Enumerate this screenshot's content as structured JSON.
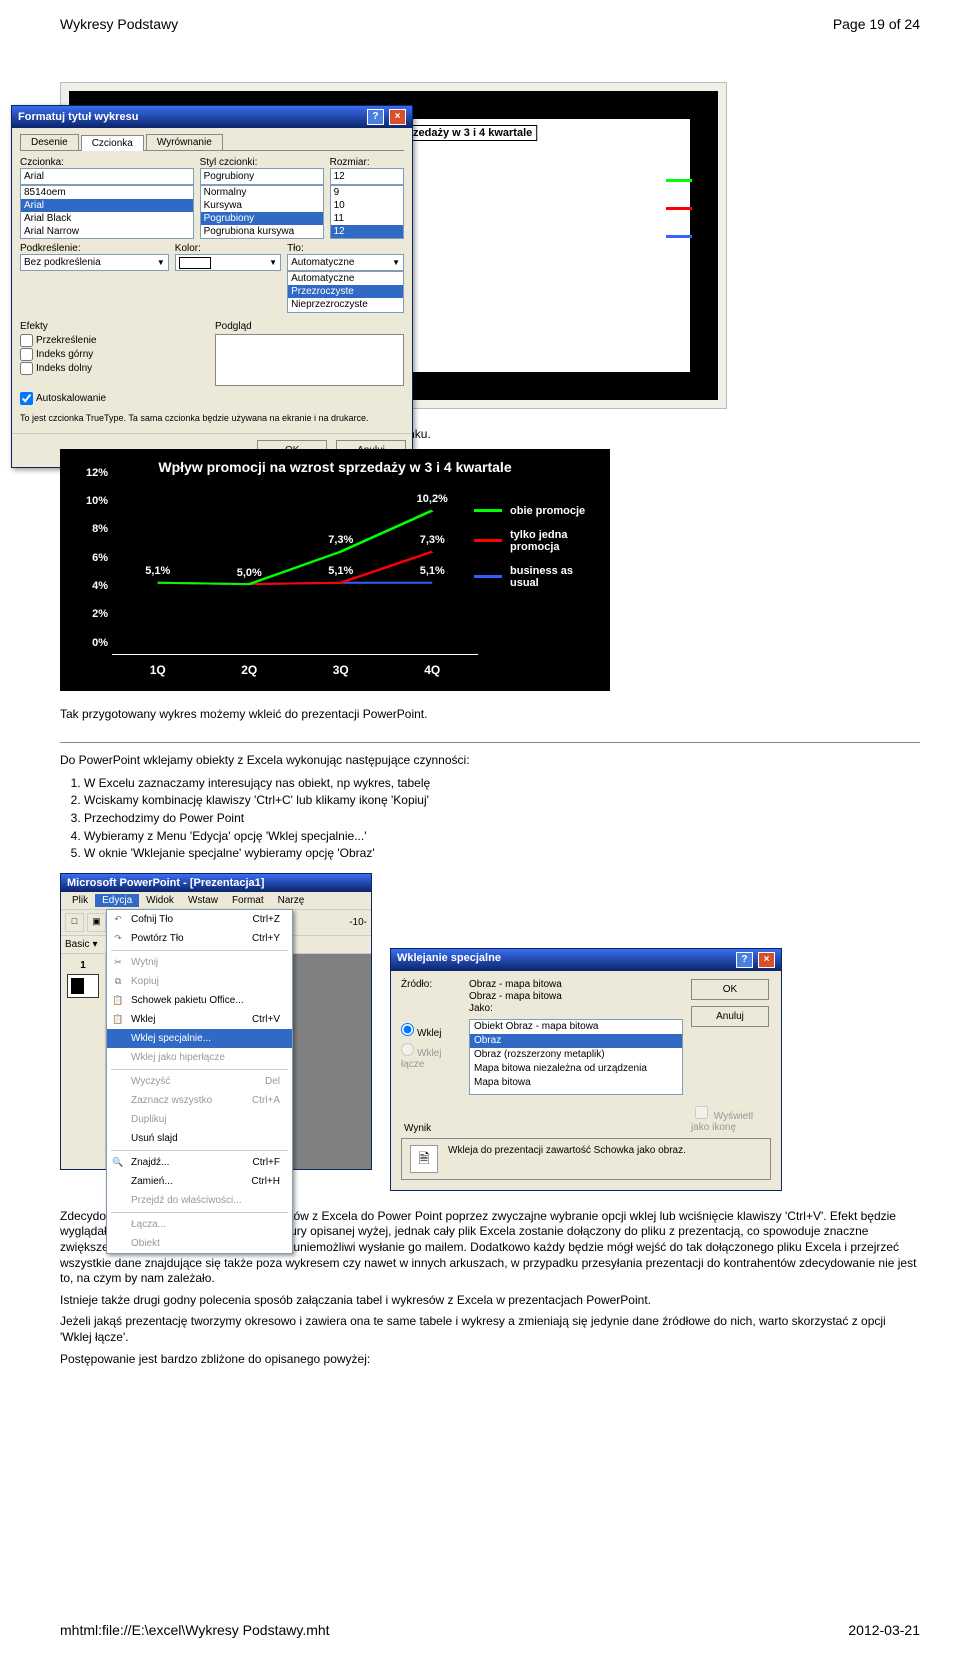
{
  "header": {
    "title": "Wykresy Podstawy",
    "page": "Page 19 of 24"
  },
  "footer": {
    "path": "mhtml:file://E:\\excel\\Wykresy Podstawy.mht",
    "date": "2012-03-21"
  },
  "text": {
    "p1": "W efekcie uzyskamy wykres taki jak pokazany na poniższym rysunku.",
    "p2": "Tak przygotowany wykres możemy wkleić do prezentacji PowerPoint.",
    "p3": "Do PowerPoint wklejamy obiekty z Excela wykonując następujące czynności:",
    "list": [
      "W Excelu zaznaczamy interesujący nas obiekt, np wykres, tabelę",
      "Wciskamy kombinację klawiszy 'Ctrl+C' lub klikamy ikonę 'Kopiuj'",
      "Przechodzimy do Power Point",
      "Wybieramy z Menu 'Edycja' opcję 'Wklej specjalnie...'",
      "W oknie 'Wklejanie specjalne' wybieramy opcję 'Obraz'"
    ],
    "p4": "Zdecydowanie nie polecam wklejania obiektów z Excela do Power Point poprzez zwyczajne wybranie opcji wklej lub wciśnięcie klawiszy 'Ctrl+V'. Efekt będzie wyglądał tak samo jak korzystając z procedury opisanej wyżej, jednak cały plik Excela zostanie dołączony do pliku z prezentacją, co spowoduje znaczne zwiększenie rozmiaru pliku prezentacji i np. uniemożliwi wysłanie go mailem. Dodatkowo każdy będzie mógł wejść do tak dołączonego pliku Excela i przejrzeć wszystkie dane znajdujące się także poza wykresem czy nawet w innych arkuszach, w przypadku przesyłania prezentacji do kontrahentów zdecydowanie nie jest to, na czym by nam zależało.",
    "p5": "Istnieje także drugi godny polecenia sposób załączania tabel i wykresów z Excela w prezentacjach PowerPoint.",
    "p6": "Jeżeli jakąś prezentację tworzymy okresowo i zawiera ona te same tabele i wykresy a zmieniają się jedynie dane źródłowe do nich, warto skorzystać z opcji 'Wklej łącze'.",
    "p7": "Postępowanie jest bardzo zbliżone do opisanego powyżej:"
  },
  "format_dialog": {
    "title": "Formatuj tytuł wykresu",
    "tabs": {
      "t1": "Desenie",
      "t2": "Czcionka",
      "t3": "Wyrównanie"
    },
    "labels": {
      "font": "Czcionka:",
      "style": "Styl czcionki:",
      "size": "Rozmiar:",
      "underline": "Podkreślenie:",
      "color": "Kolor:",
      "background": "Tło:",
      "effects": "Efekty",
      "preview": "Podgląd"
    },
    "values": {
      "font": "Arial",
      "style": "Pogrubiony",
      "size": "12",
      "underline": "Bez podkreślenia",
      "color": "",
      "background": "Automatyczne"
    },
    "font_list": {
      "i1": "8514oem",
      "i2": "Arial",
      "i3": "Arial Black",
      "i4": "Arial Narrow"
    },
    "style_list": {
      "i1": "Normalny",
      "i2": "Kursywa",
      "i3": "Pogrubiony",
      "i4": "Pogrubiona kursywa"
    },
    "size_list": {
      "i1": "9",
      "i2": "10",
      "i3": "11",
      "i4": "12"
    },
    "bg_list": {
      "i1": "Automatyczne",
      "i2": "Przezroczyste",
      "i3": "Nieprzezroczyste"
    },
    "effects": {
      "strike": "Przekreślenie",
      "super": "Indeks górny",
      "sub": "Indeks dolny",
      "autoscale": "Autoskalowanie"
    },
    "note": "To jest czcionka TrueType. Ta sama czcionka będzie używana na ekranie i na drukarce.",
    "buttons": {
      "ok": "OK",
      "cancel": "Anuluj"
    },
    "chart_title": "Wpływ promocji na wzrost sprzedaży w 3 i 4 kwartale"
  },
  "chart_data": {
    "type": "line",
    "title": "Wpływ promocji na wzrost sprzedaży w 3 i 4 kwartale",
    "categories": [
      "1Q",
      "2Q",
      "3Q",
      "4Q"
    ],
    "ylim": [
      0,
      12
    ],
    "yticks": [
      "0%",
      "2%",
      "4%",
      "6%",
      "8%",
      "10%",
      "12%"
    ],
    "series": [
      {
        "name": "obie promocje",
        "color": "#00ff00",
        "values": [
          5.1,
          5.0,
          7.3,
          10.2
        ]
      },
      {
        "name": "tylko jedna promocja",
        "color": "#ff0000",
        "values": [
          5.1,
          5.0,
          5.1,
          7.3
        ]
      },
      {
        "name": "business as usual",
        "color": "#3060ff",
        "values": [
          5.1,
          5.0,
          5.1,
          5.1
        ]
      }
    ],
    "labels": {
      "l51a": "5,1%",
      "l50": "5,0%",
      "l51b": "5,1%",
      "l51c": "5,1%",
      "l73a": "7,3%",
      "l73b": "7,3%",
      "l102": "10,2%"
    },
    "legend": {
      "s0": "obie promocje",
      "s1": "tylko jedna promocja",
      "s2": "business as usual"
    }
  },
  "pp": {
    "title": "Microsoft PowerPoint - [Prezentacja1]",
    "menu": {
      "plik": "Plik",
      "edycja": "Edycja",
      "widok": "Widok",
      "wstaw": "Wstaw",
      "format": "Format",
      "narz": "Narzę"
    },
    "toolbar": {
      "basic": "Basic"
    },
    "zoom": "-10-",
    "slide_num": "1"
  },
  "edit_menu": {
    "undo": "Cofnij Tło",
    "undo_sc": "Ctrl+Z",
    "redo": "Powtórz Tło",
    "redo_sc": "Ctrl+Y",
    "cut": "Wytnij",
    "copy": "Kopiuj",
    "office_clip": "Schowek pakietu Office...",
    "paste": "Wklej",
    "paste_sc": "Ctrl+V",
    "paste_special": "Wklej specjalnie...",
    "paste_link": "Wklej jako hiperłącze",
    "clear": "Wyczyść",
    "clear_sc": "Del",
    "select_all": "Zaznacz wszystko",
    "select_all_sc": "Ctrl+A",
    "duplicate": "Duplikuj",
    "delete_slide": "Usuń slajd",
    "find": "Znajdź...",
    "find_sc": "Ctrl+F",
    "replace": "Zamień...",
    "replace_sc": "Ctrl+H",
    "goto_prop": "Przejdź do właściwości...",
    "links": "Łącza...",
    "object": "Obiekt"
  },
  "paste_special": {
    "title": "Wklejanie specjalne",
    "source_lbl": "Źródło:",
    "source_val1": "Obraz - mapa bitowa",
    "source_val2": "Obraz - mapa bitowa",
    "as_lbl": "Jako:",
    "radio_paste": "Wklej",
    "radio_link": "Wklej łącze",
    "list": {
      "i1": "Obiekt Obraz - mapa bitowa",
      "i2": "Obraz",
      "i3": "Obraz (rozszerzony metaplik)",
      "i4": "Mapa bitowa niezależna od urządzenia",
      "i5": "Mapa bitowa"
    },
    "show_icon": "Wyświetl jako ikonę",
    "result_lbl": "Wynik",
    "result_text": "Wkleja do prezentacji zawartość Schowka jako obraz.",
    "buttons": {
      "ok": "OK",
      "cancel": "Anuluj"
    }
  }
}
